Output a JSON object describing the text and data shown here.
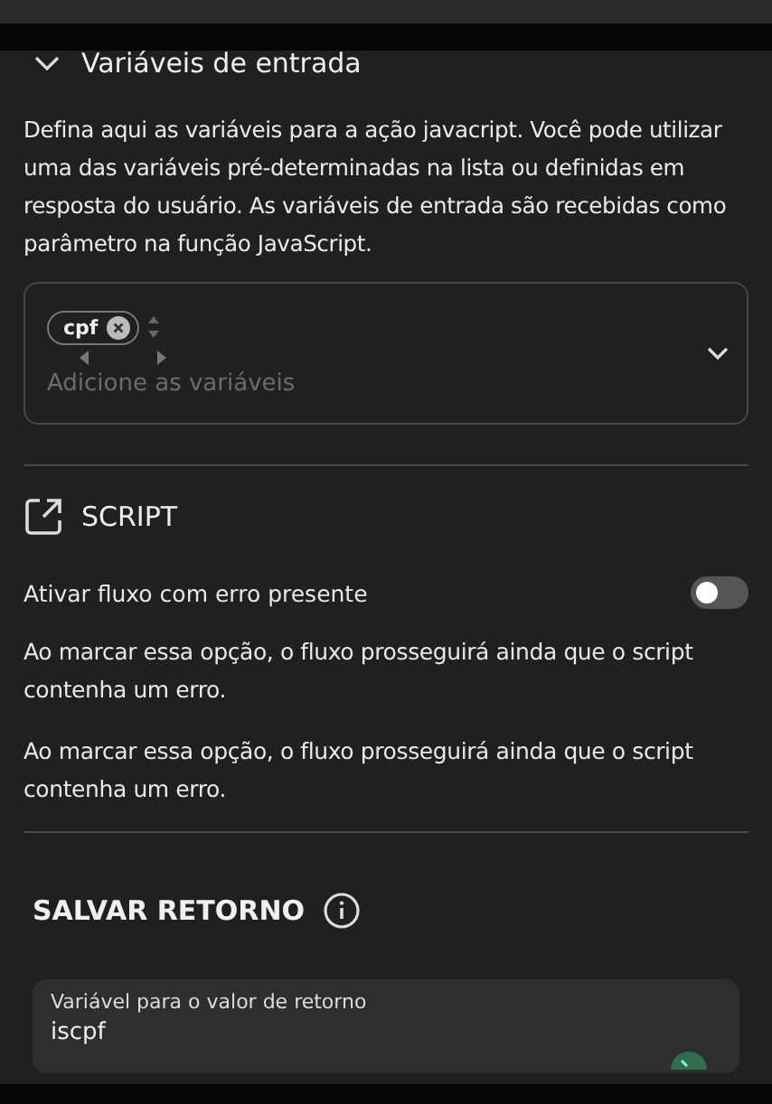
{
  "input_section": {
    "title": "Variáveis de entrada",
    "expanded": true,
    "description": "Defina aqui as variáveis para a ação javacript. Você pode utilizar uma das variáveis pré-determinadas na lista ou definidas em resposta do usuário. As variáveis de entrada são recebidas como parâmetro na função JavaScript.",
    "tags": [
      {
        "label": "cpf"
      }
    ],
    "placeholder": "Adicione as variáveis"
  },
  "script_section": {
    "title": "SCRIPT",
    "toggle": {
      "label": "Ativar fluxo com erro presente",
      "on": false
    },
    "notes": [
      "Ao marcar essa opção, o fluxo prosseguirá ainda que o script contenha um erro.",
      "Ao marcar essa opção, o fluxo prosseguirá ainda que o script contenha um erro."
    ]
  },
  "save_return": {
    "title": "SALVAR RETORNO",
    "field": {
      "label": "Variável para o valor de retorno",
      "value": "iscpf",
      "valid": true
    }
  }
}
